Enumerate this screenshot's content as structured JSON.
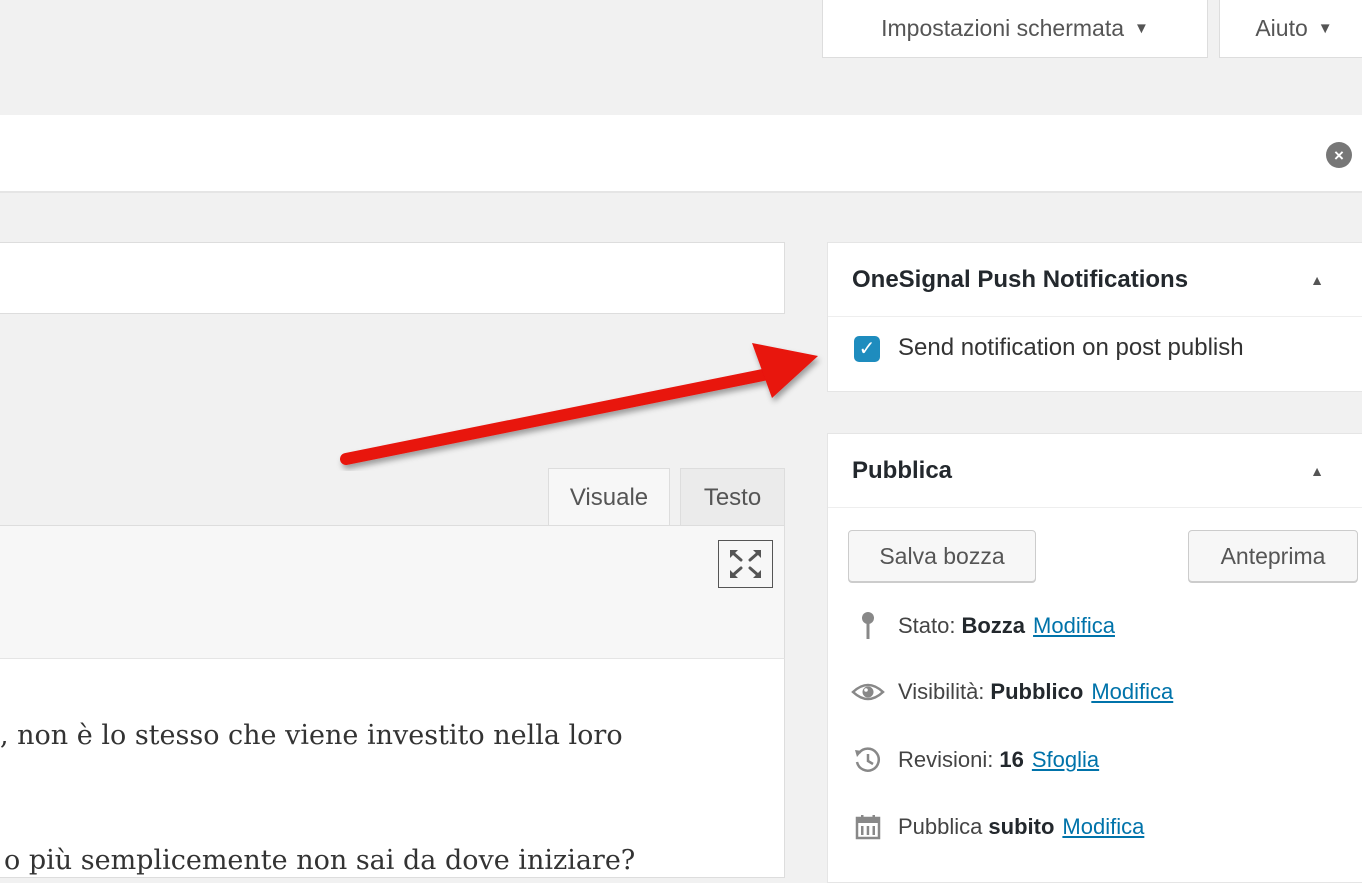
{
  "header": {
    "screen_options_label": "Impostazioni schermata",
    "help_label": "Aiuto",
    "dropdown_caret": "▼"
  },
  "notice": {
    "dismiss_glyph": "×"
  },
  "editor": {
    "tabs": [
      {
        "label": "Visuale",
        "active": true
      },
      {
        "label": "Testo",
        "active": false
      }
    ],
    "content_lines": [
      ", non è lo stesso che viene investito nella loro",
      "o più semplicemente non sai da dove iniziare?"
    ]
  },
  "onesignal_box": {
    "title": "OneSignal Push Notifications",
    "checkbox_label": "Send notification on post publish",
    "checked": true
  },
  "publish_box": {
    "title": "Pubblica",
    "save_draft_label": "Salva bozza",
    "preview_label": "Anteprima",
    "status": {
      "label": "Stato:",
      "value": "Bozza",
      "link": "Modifica"
    },
    "visibility": {
      "label": "Visibilità:",
      "value": "Pubblico",
      "link": "Modifica"
    },
    "revisions": {
      "label": "Revisioni:",
      "value": "16",
      "link": "Sfoglia"
    },
    "schedule": {
      "label": "Pubblica",
      "value": "subito",
      "link": "Modifica"
    }
  },
  "colors": {
    "accent": "#0073aa",
    "checkbox": "#1e8cbe",
    "arrow": "#e8120c"
  }
}
